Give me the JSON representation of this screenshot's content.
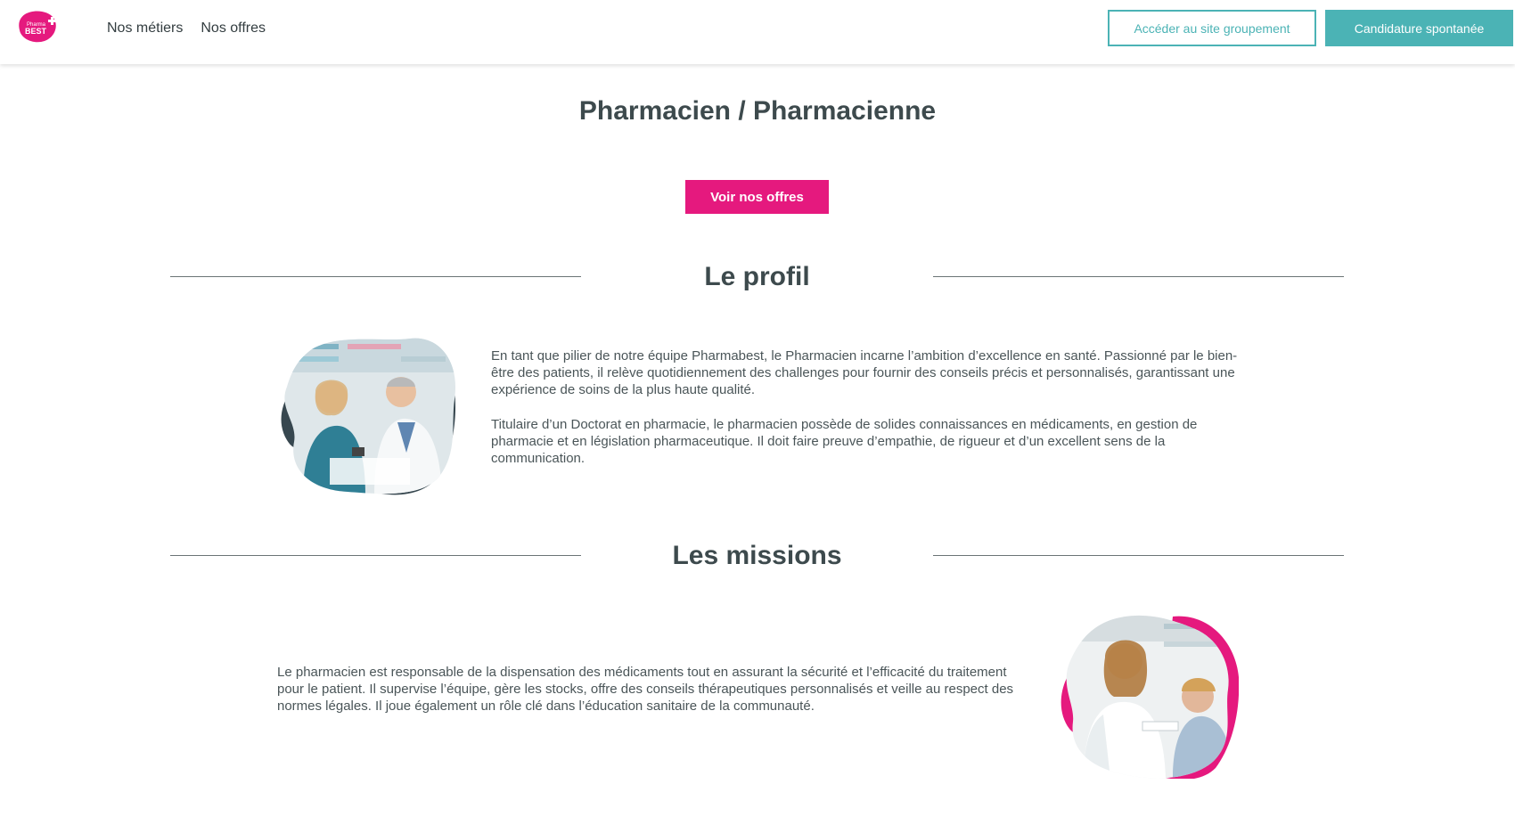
{
  "header": {
    "logo_text": "Pharma BEST",
    "nav": [
      {
        "label": "Nos métiers"
      },
      {
        "label": "Nos offres"
      }
    ],
    "group_site_label": "Accéder au site groupement",
    "spontaneous_label": "Candidature spontanée"
  },
  "main": {
    "title": "Pharmacien / Pharmacienne",
    "cta_label": "Voir nos offres",
    "profile": {
      "heading": "Le profil",
      "paragraph1": "En tant que pilier de notre équipe Pharmabest, le Pharmacien incarne l’ambition d’excellence en santé. Passionné par le bien-être des patients, il relève quotidiennement des challenges pour fournir des conseils précis et personnalisés, garantissant une expérience de soins de la plus haute qualité.",
      "paragraph2": "Titulaire d’un Doctorat en pharmacie, le pharmacien possède de solides connaissances en médicaments, en gestion de pharmacie et en législation pharmaceutique. Il doit faire preuve d’empathie, de rigueur et d’un excellent sens de la communication."
    },
    "missions": {
      "heading": "Les missions",
      "paragraph": "Le pharmacien est responsable de la dispensation des médicaments tout en assurant la sécurité et l’efficacité du traitement pour le patient. Il supervise l’équipe, gère les stocks, offre des conseils thérapeutiques personnalisés et veille au respect des normes légales. Il joue également un rôle clé dans l’éducation sanitaire de la communauté."
    }
  },
  "colors": {
    "teal": "#4bb3b5",
    "pink": "#e5197e",
    "dark": "#3d4a4d"
  }
}
